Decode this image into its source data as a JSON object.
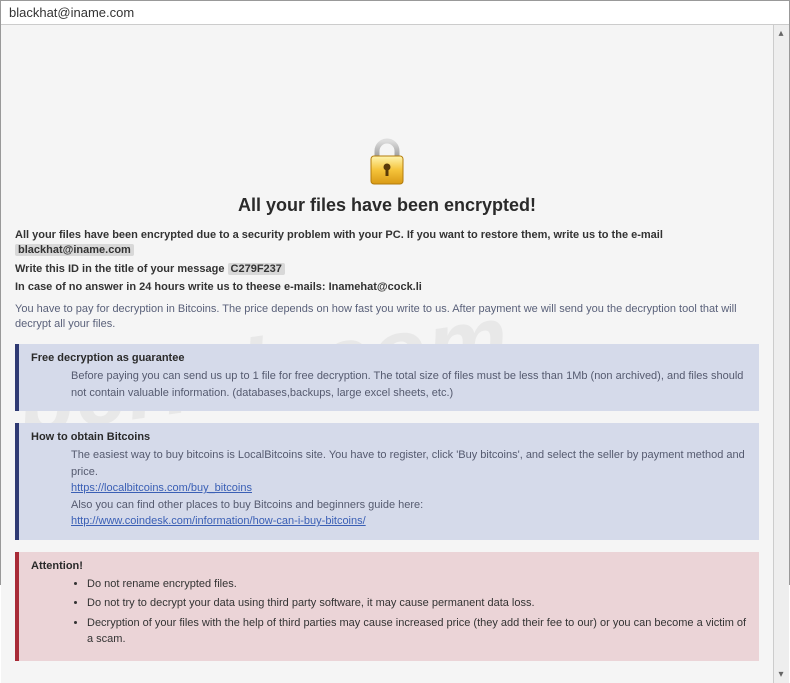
{
  "window": {
    "title": "blackhat@iname.com"
  },
  "headline": "All your files have been encrypted!",
  "intro": {
    "line1_a": "All your files have been encrypted due to a security problem with your PC. If you want to restore them, write us to the e-mail ",
    "email1": "blackhat@iname.com",
    "line2_a": "Write this ID in the title of your message ",
    "id_code": "C279F237",
    "line3_a": "In case of no answer in 24 hours write us to theese e-mails: ",
    "email2": "Inamehat@cock.li"
  },
  "payinfo": "You have to pay for decryption in Bitcoins. The price depends on how fast you write to us. After payment we will send you the decryption tool that will decrypt all your files.",
  "guarantee": {
    "title": "Free decryption as guarantee",
    "body": "Before paying you can send us up to 1 file for free decryption. The total size of files must be less than 1Mb (non archived), and files should not contain valuable information. (databases,backups, large excel sheets, etc.)"
  },
  "obtain": {
    "title": "How to obtain Bitcoins",
    "line1": "The easiest way to buy bitcoins is LocalBitcoins site. You have to register, click 'Buy bitcoins', and select the seller by payment method and price.",
    "link1": "https://localbitcoins.com/buy_bitcoins",
    "line2": "Also you can find other places to buy Bitcoins and beginners guide here:",
    "link2": "http://www.coindesk.com/information/how-can-i-buy-bitcoins/"
  },
  "attention": {
    "title": "Attention!",
    "items": [
      "Do not rename encrypted files.",
      "Do not try to decrypt your data using third party software, it may cause permanent data loss.",
      "Decryption of your files with the help of third parties may cause increased price (they add their fee to our) or you can become a victim of a scam."
    ]
  },
  "watermark": "pcrisk.com"
}
